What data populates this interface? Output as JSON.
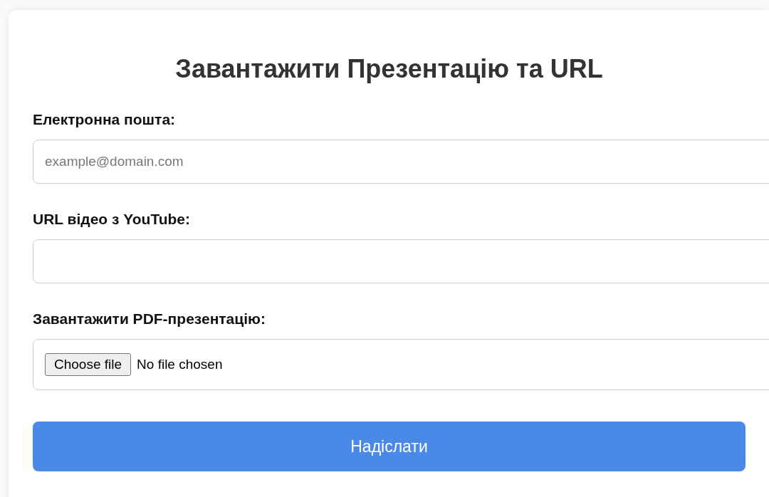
{
  "title": "Завантажити Презентацію та URL",
  "fields": [
    {
      "kind": "text",
      "label": "Електронна пошта:",
      "placeholder": "example@domain.com"
    },
    {
      "kind": "text",
      "label": "URL відео з YouTube:"
    },
    {
      "kind": "file",
      "label": "Завантажити PDF-презентацію:",
      "button": "Choose file",
      "status": "No file chosen"
    }
  ],
  "submit": "Надіслати"
}
